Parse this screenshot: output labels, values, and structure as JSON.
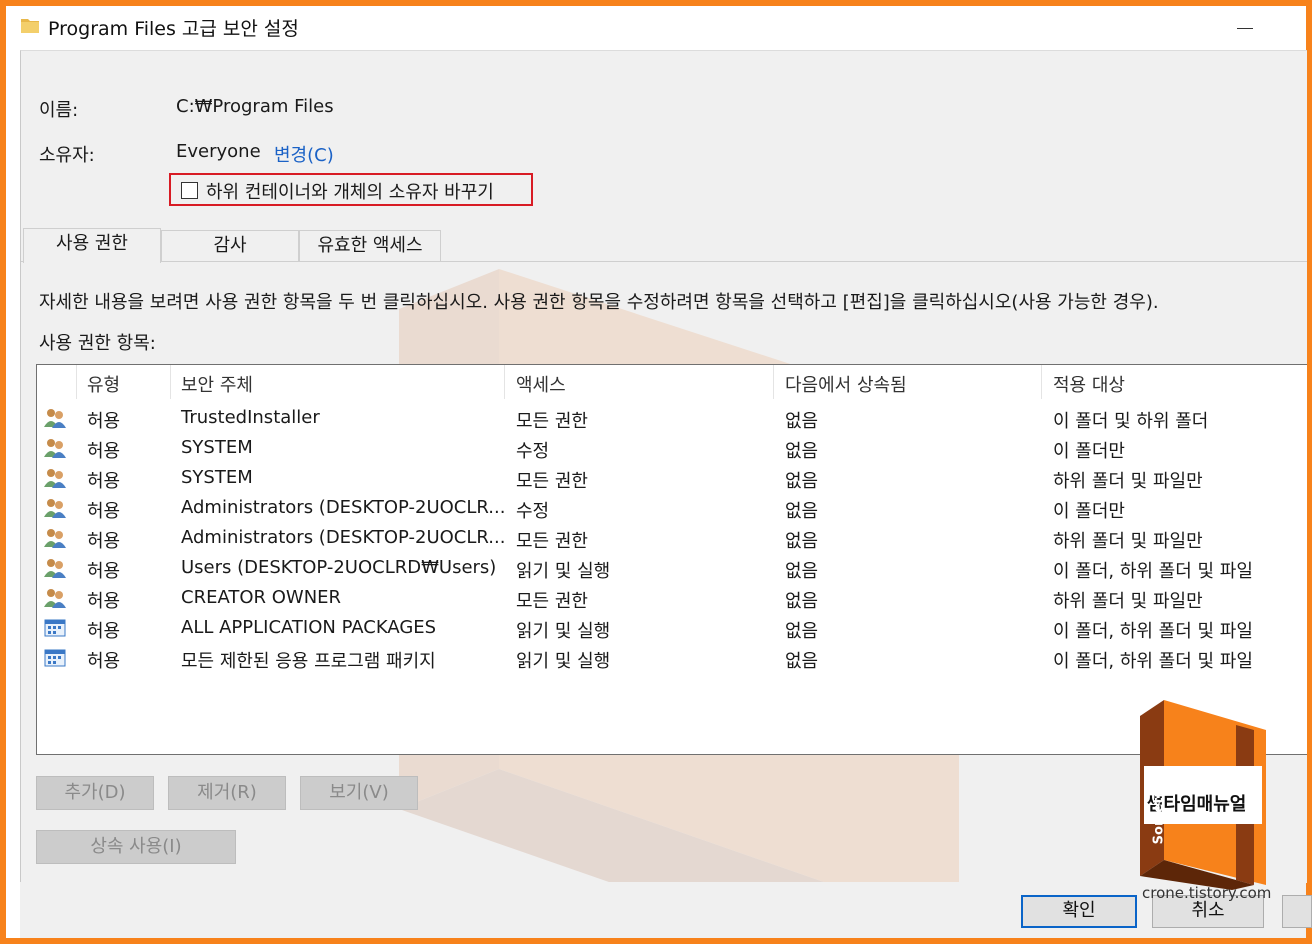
{
  "window": {
    "title": "Program Files 고급 보안 설정"
  },
  "fields": {
    "name_label": "이름:",
    "name_value": "C:₩Program Files",
    "owner_label": "소유자:",
    "owner_value": "Everyone",
    "change_link": "변경(C)",
    "replace_owner_checkbox": "하위 컨테이너와 개체의 소유자 바꾸기"
  },
  "tabs": [
    {
      "label": "사용 권한",
      "active": true
    },
    {
      "label": "감사",
      "active": false
    },
    {
      "label": "유효한 액세스",
      "active": false
    }
  ],
  "instructions": "자세한 내용을 보려면 사용 권한 항목을 두 번 클릭하십시오. 사용 권한 항목을 수정하려면 항목을 선택하고 [편집]을 클릭하십시오(사용 가능한 경우).",
  "entries_label": "사용 권한 항목:",
  "table": {
    "headers": [
      "유형",
      "보안 주체",
      "액세스",
      "다음에서 상속됨",
      "적용 대상"
    ],
    "rows": [
      {
        "icon": "users-icon",
        "type": "허용",
        "principal": "TrustedInstaller",
        "access": "모든 권한",
        "inherited": "없음",
        "applies": "이 폴더 및 하위 폴더"
      },
      {
        "icon": "users-icon",
        "type": "허용",
        "principal": "SYSTEM",
        "access": "수정",
        "inherited": "없음",
        "applies": "이 폴더만"
      },
      {
        "icon": "users-icon",
        "type": "허용",
        "principal": "SYSTEM",
        "access": "모든 권한",
        "inherited": "없음",
        "applies": "하위 폴더 및 파일만"
      },
      {
        "icon": "users-icon",
        "type": "허용",
        "principal": "Administrators (DESKTOP-2UOCLR...",
        "access": "수정",
        "inherited": "없음",
        "applies": "이 폴더만"
      },
      {
        "icon": "users-icon",
        "type": "허용",
        "principal": "Administrators (DESKTOP-2UOCLR...",
        "access": "모든 권한",
        "inherited": "없음",
        "applies": "하위 폴더 및 파일만"
      },
      {
        "icon": "users-icon",
        "type": "허용",
        "principal": "Users (DESKTOP-2UOCLRD₩Users)",
        "access": "읽기 및 실행",
        "inherited": "없음",
        "applies": "이 폴더, 하위 폴더 및 파일"
      },
      {
        "icon": "users-icon",
        "type": "허용",
        "principal": "CREATOR OWNER",
        "access": "모든 권한",
        "inherited": "없음",
        "applies": "하위 폴더 및 파일만"
      },
      {
        "icon": "app-package-icon",
        "type": "허용",
        "principal": "ALL APPLICATION PACKAGES",
        "access": "읽기 및 실행",
        "inherited": "없음",
        "applies": "이 폴더, 하위 폴더 및 파일"
      },
      {
        "icon": "app-package-icon",
        "type": "허용",
        "principal": "모든 제한된 응용 프로그램 패키지",
        "access": "읽기 및 실행",
        "inherited": "없음",
        "applies": "이 폴더, 하위 폴더 및 파일"
      }
    ]
  },
  "buttons": {
    "add": "추가(D)",
    "remove": "제거(R)",
    "view": "보기(V)",
    "inheritance": "상속 사용(I)",
    "ok": "확인",
    "cancel": "취소"
  },
  "logo": {
    "text": "썸타임매뉴얼",
    "side_text": "Sometime",
    "url": "crone.tistory.com"
  },
  "colors": {
    "frame": "#f7821b",
    "highlight": "#d81b24",
    "link": "#1b62c6",
    "logo_orange": "#f7821b"
  }
}
